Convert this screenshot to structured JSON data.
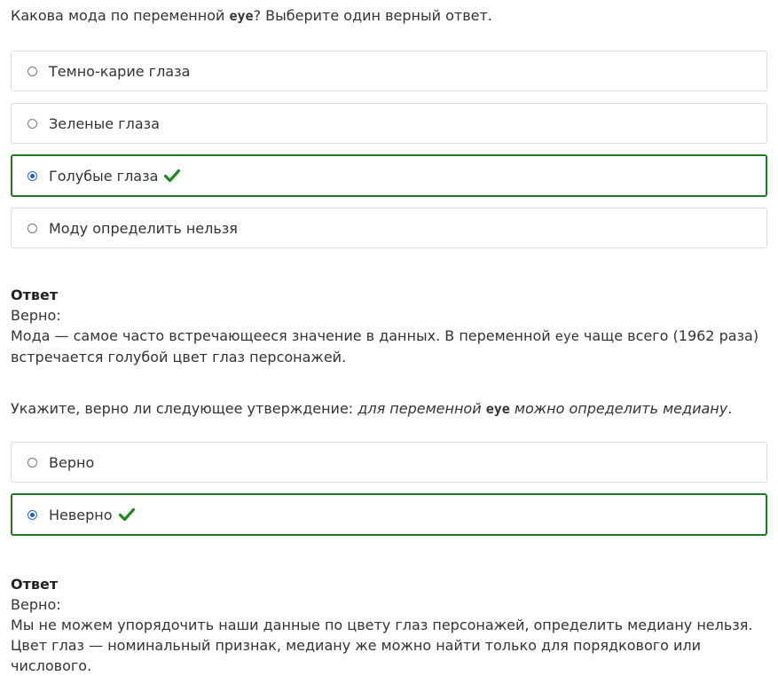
{
  "q1": {
    "prefix": "Какова мода по переменной ",
    "code": "eye",
    "suffix": "? Выберите один верный ответ.",
    "options": [
      {
        "label": "Темно-карие глаза",
        "selected": false,
        "correct": false
      },
      {
        "label": "Зеленые глаза",
        "selected": false,
        "correct": false
      },
      {
        "label": "Голубые глаза",
        "selected": true,
        "correct": true
      },
      {
        "label": "Моду определить нельзя",
        "selected": false,
        "correct": false
      }
    ],
    "answer": {
      "title": "Ответ",
      "verdict": "Верно:",
      "text_prefix": "Мода — самое часто встречающееся значение в данных. В переменной ",
      "text_code": "eye",
      "text_suffix": " чаще всего (1962 раза) встречается голубой цвет глаз персонажей."
    }
  },
  "q2": {
    "prefix": "Укажите, верно ли следующее утверждение: ",
    "italic_prefix": "для переменной ",
    "code": "eye",
    "italic_suffix": " можно определить медиану",
    "end": ".",
    "options": [
      {
        "label": "Верно",
        "selected": false,
        "correct": false
      },
      {
        "label": "Неверно",
        "selected": true,
        "correct": true
      }
    ],
    "answer": {
      "title": "Ответ",
      "verdict": "Верно:",
      "text": "Мы не можем упорядочить наши данные по цвету глаз персонажей, определить медиану нельзя. Цвет глаз — номинальный признак, медиану же можно найти только для порядкового или числового."
    }
  },
  "colors": {
    "correct_border": "#1e7a1e",
    "check": "#1e8a1e",
    "radio_selected": "#1a5fd0"
  }
}
